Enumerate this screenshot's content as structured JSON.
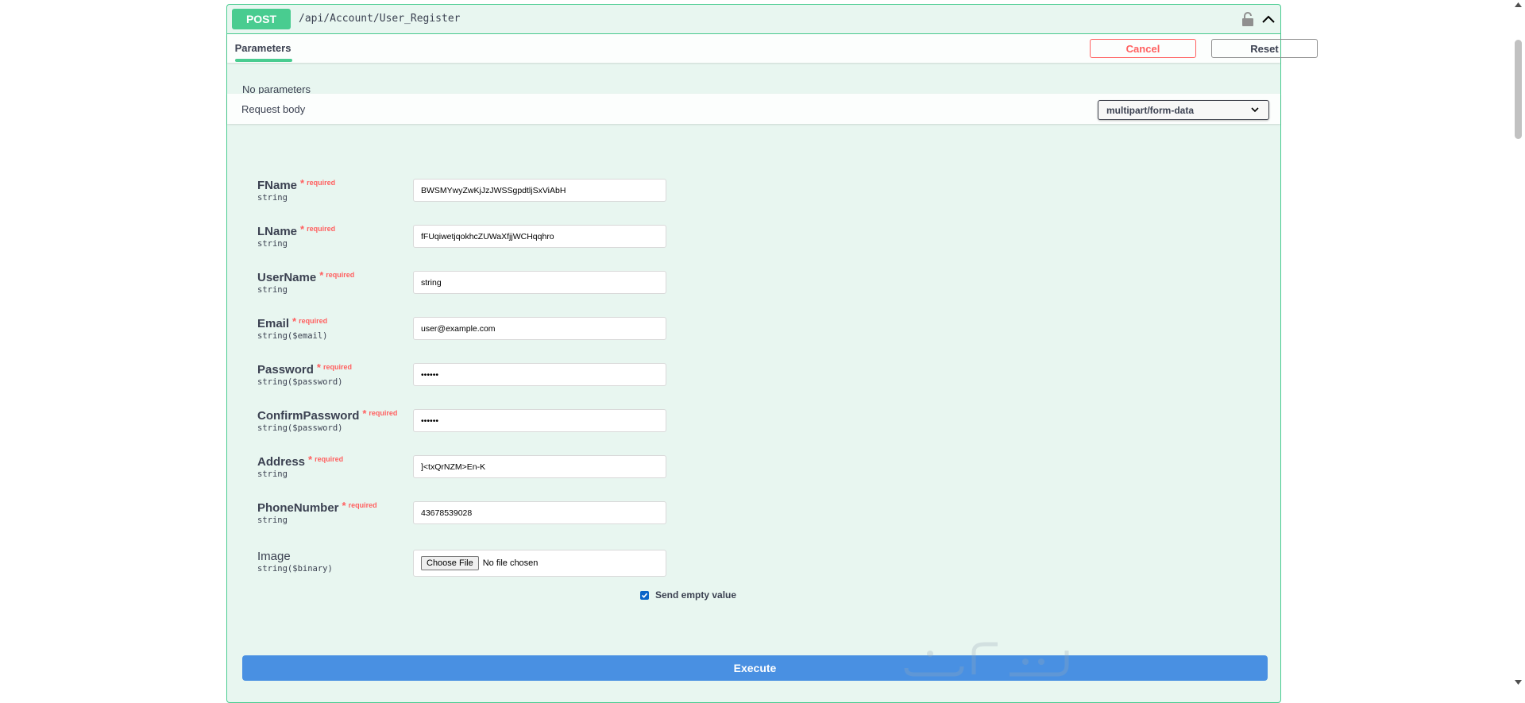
{
  "operation": {
    "method": "POST",
    "path": "/api/Account/User_Register"
  },
  "tabs": {
    "parameters": "Parameters",
    "cancel": "Cancel",
    "reset": "Reset"
  },
  "no_parameters": "No parameters",
  "request_body": {
    "label": "Request body",
    "content_type": "multipart/form-data"
  },
  "required_text": "required",
  "fields": [
    {
      "name": "FName",
      "type": "string",
      "required": true,
      "value": "BWSMYwyZwKjJzJWSSgpdtljSxViAbH"
    },
    {
      "name": "LName",
      "type": "string",
      "required": true,
      "value": "fFUqiwetjqokhcZUWaXfjjWCHqqhro"
    },
    {
      "name": "UserName",
      "type": "string",
      "required": true,
      "value": "string"
    },
    {
      "name": "Email",
      "type": "string($email)",
      "required": true,
      "value": "user@example.com"
    },
    {
      "name": "Password",
      "type": "string($password)",
      "required": true,
      "value": "••••••"
    },
    {
      "name": "ConfirmPassword",
      "type": "string($password)",
      "required": true,
      "value": "••••••"
    },
    {
      "name": "Address",
      "type": "string",
      "required": true,
      "value": "]<txQrNZM>En-K"
    },
    {
      "name": "PhoneNumber",
      "type": "string",
      "required": true,
      "value": "43678539028"
    }
  ],
  "image_field": {
    "name": "Image",
    "type": "string($binary)",
    "choose_file": "Choose File",
    "no_file": "No file chosen"
  },
  "send_empty_value": "Send empty value",
  "execute": "Execute",
  "colors": {
    "post_green": "#49cc90",
    "danger": "#ff6060",
    "execute_blue": "#4990e2"
  }
}
